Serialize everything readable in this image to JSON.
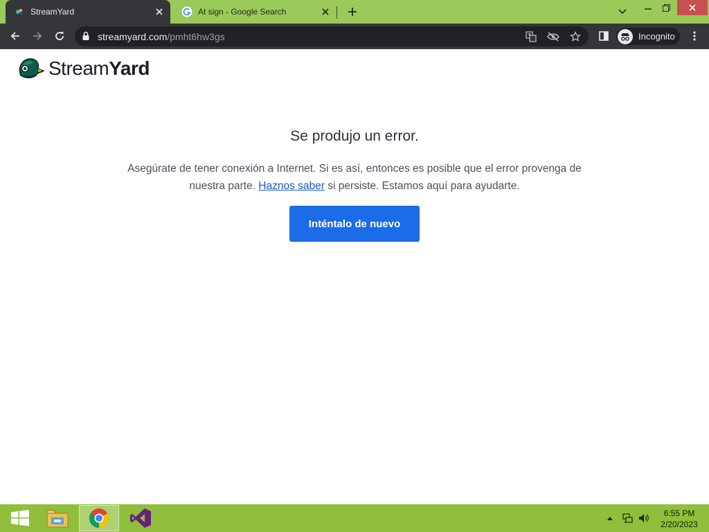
{
  "browser": {
    "tabs": [
      {
        "title": "StreamYard",
        "active": true,
        "favicon": "streamyard-favicon"
      },
      {
        "title": "At sign - Google Search",
        "active": false,
        "favicon": "google-favicon"
      }
    ],
    "url_host": "streamyard.com",
    "url_path": "/pmht6hw3gs",
    "profile_label": "Incognito",
    "accent_color": "#9bc95a"
  },
  "page": {
    "brand_light": "Stream",
    "brand_bold": "Yard",
    "error_title": "Se produjo un error.",
    "message_part1": "Asegúrate de tener conexión a Internet. Si es así, entonces es posible que el error provenga de nuestra parte.",
    "message_link": "Haznos saber",
    "message_part2": "si persiste. Estamos aquí para ayudarte.",
    "retry_label": "Inténtalo de nuevo",
    "button_color": "#1a6ce8"
  },
  "taskbar": {
    "items": [
      "windows-start",
      "file-explorer",
      "google-chrome",
      "visual-studio"
    ],
    "time": "6:55 PM",
    "date": "2/20/2023"
  }
}
